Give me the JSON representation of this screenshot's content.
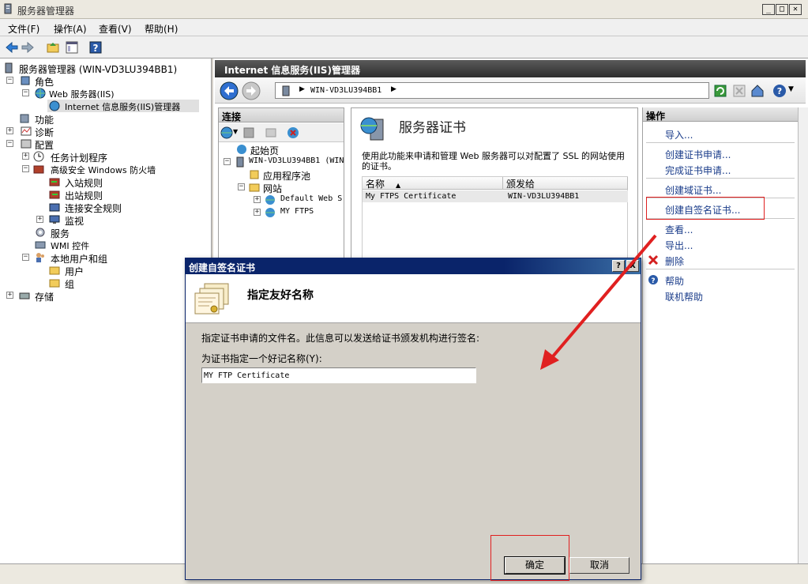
{
  "window": {
    "title": "服务器管理器"
  },
  "menu": [
    "文件(F)",
    "操作(A)",
    "查看(V)",
    "帮助(H)"
  ],
  "tree": [
    {
      "label": "服务器管理器 (WIN-VD3LU394BB1)"
    },
    {
      "label": "角色"
    },
    {
      "label": "Web 服务器(IIS)"
    },
    {
      "label": "Internet 信息服务(IIS)管理器"
    },
    {
      "label": "功能"
    },
    {
      "label": "诊断"
    },
    {
      "label": "配置"
    },
    {
      "label": "任务计划程序"
    },
    {
      "label": "高级安全 Windows 防火墙"
    },
    {
      "label": "入站规则"
    },
    {
      "label": "出站规则"
    },
    {
      "label": "连接安全规则"
    },
    {
      "label": "监视"
    },
    {
      "label": "服务"
    },
    {
      "label": "WMI 控件"
    },
    {
      "label": "本地用户和组"
    },
    {
      "label": "用户"
    },
    {
      "label": "组"
    },
    {
      "label": "存储"
    }
  ],
  "iis": {
    "header": "Internet 信息服务(IIS)管理器",
    "address": "WIN-VD3LU394BB1"
  },
  "connections": {
    "title": "连接",
    "items": [
      {
        "label": "起始页"
      },
      {
        "label": "WIN-VD3LU394BB1 (WIN"
      },
      {
        "label": "应用程序池"
      },
      {
        "label": "网站"
      },
      {
        "label": "Default Web S"
      },
      {
        "label": "MY FTPS"
      }
    ]
  },
  "certs": {
    "title": "服务器证书",
    "description": "使用此功能来申请和管理 Web 服务器可以对配置了 SSL 的网站使用的证书。",
    "columns": [
      "名称",
      "颁发给"
    ],
    "rows": [
      {
        "name": "My FTPS Certificate",
        "issued_to": "WIN-VD3LU394BB1"
      }
    ]
  },
  "actions": {
    "title": "操作",
    "items": [
      {
        "label": "导入..."
      },
      {
        "label": "创建证书申请..."
      },
      {
        "label": "完成证书申请..."
      },
      {
        "label": "创建域证书..."
      },
      {
        "label": "创建自签名证书..."
      },
      {
        "label": "查看..."
      },
      {
        "label": "导出..."
      },
      {
        "label": "删除"
      },
      {
        "label": "帮助"
      },
      {
        "label": "联机帮助"
      }
    ]
  },
  "dialog": {
    "title": "创建自签名证书",
    "title_buttons": [
      "?",
      "X"
    ],
    "heading": "指定友好名称",
    "info": "指定证书申请的文件名。此信息可以发送给证书颁发机构进行签名:",
    "field_label": "为证书指定一个好记名称(Y):",
    "field_value": "MY FTP Certificate",
    "ok": "确定",
    "cancel": "取消"
  },
  "colors": {
    "annotation": "#e02020",
    "dialog_title": "#0a246a",
    "link": "#1a3c8a"
  },
  "icons": [
    "server-manager-icon",
    "back-icon",
    "forward-icon",
    "folder-up-icon",
    "console-icon",
    "help-icon",
    "globe-icon",
    "certificate-icon",
    "delete-icon",
    "arrow-annotation"
  ]
}
